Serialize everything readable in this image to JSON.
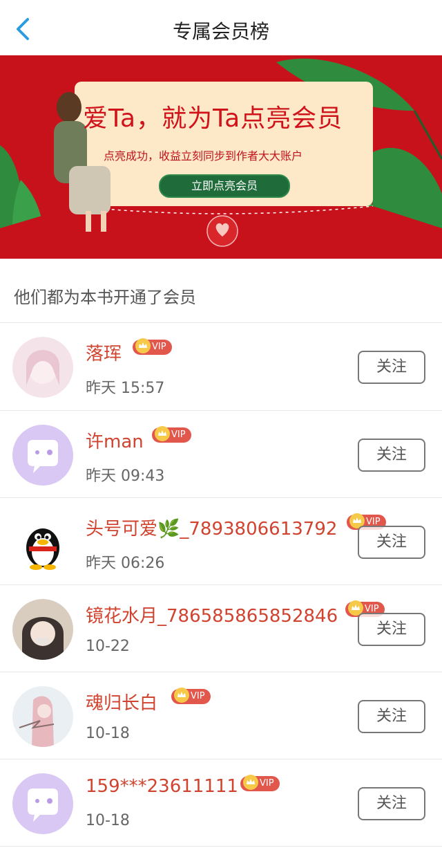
{
  "header": {
    "title": "专属会员榜"
  },
  "banner": {
    "title": "爱Ta，就为Ta点亮会员",
    "subtitle": "点亮成功，收益立刻同步到作者大大账户",
    "button": "立即点亮会员"
  },
  "section_title": "他们都为本书开通了会员",
  "members": [
    {
      "name": "落珲",
      "badge": "VIP",
      "time": "昨天 15:57",
      "follow": "关注"
    },
    {
      "name": "许man",
      "badge": "VIP",
      "time": "昨天 09:43",
      "follow": "关注"
    },
    {
      "name": "头号可爱🌿_7893806613792",
      "badge": "VIP",
      "time": "昨天 06:26",
      "follow": "关注"
    },
    {
      "name": "镜花水月_786585865852846",
      "badge": "VIP",
      "time": "10-22",
      "follow": "关注"
    },
    {
      "name": "魂归长白",
      "badge": "VIP",
      "time": "10-18",
      "follow": "关注"
    },
    {
      "name": "159***23611111",
      "badge": "VIP",
      "time": "10-18",
      "follow": "关注"
    }
  ],
  "colors": {
    "accent": "#d0432f",
    "banner_bg": "#c8121b",
    "vip_bg": "#e2574c",
    "back_arrow": "#2b9be0"
  }
}
